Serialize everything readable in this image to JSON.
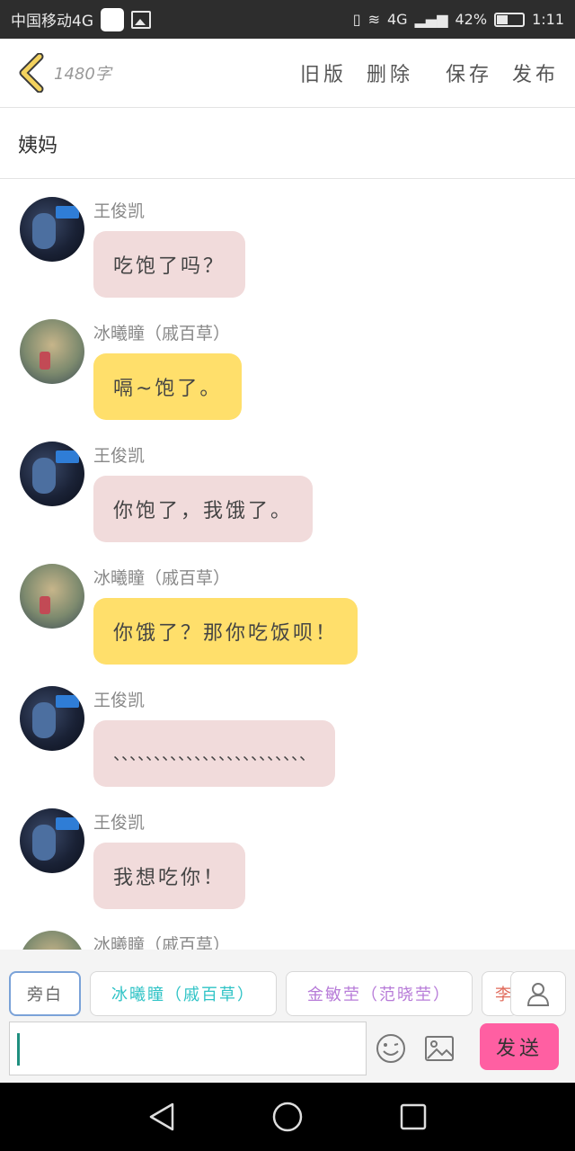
{
  "status_bar": {
    "carrier": "中国移动4G",
    "network": "4G",
    "battery_percent": "42%",
    "time": "1:11",
    "battery_level": 0.42
  },
  "toolbar": {
    "word_count": "1480字",
    "old_version": "旧版",
    "delete": "删除",
    "save": "保存",
    "publish": "发布"
  },
  "title": "姨妈",
  "messages": [
    {
      "name": "王俊凯",
      "text": "吃饱了吗？",
      "avatar": "boy",
      "color": "pink"
    },
    {
      "name": "冰曦瞳（戚百草）",
      "text": "嗝~饱了。",
      "avatar": "girl",
      "color": "yellow"
    },
    {
      "name": "王俊凯",
      "text": "你饱了，我饿了。",
      "avatar": "boy",
      "color": "pink"
    },
    {
      "name": "冰曦瞳（戚百草）",
      "text": "你饿了？那你吃饭呗！",
      "avatar": "girl",
      "color": "yellow"
    },
    {
      "name": "王俊凯",
      "text": "、、、、、、、、、、、、、、、、、、、、、、、、",
      "avatar": "boy",
      "color": "pink"
    },
    {
      "name": "王俊凯",
      "text": "我想吃你！",
      "avatar": "boy",
      "color": "pink"
    },
    {
      "name": "冰曦瞳（戚百草）",
      "text": "",
      "avatar": "girl",
      "color": "yellow"
    }
  ],
  "roles": {
    "narrator": "旁白",
    "role1": "冰曦瞳（戚百草）",
    "role2": "金敏茔（范晓茔）",
    "role3": "李"
  },
  "input": {
    "value": "",
    "send": "发送"
  },
  "colors": {
    "pink_bubble": "#f1dbdb",
    "yellow_bubble": "#ffdf6b",
    "send_button": "#ff5fa2",
    "role1": "#2fc3c6",
    "role2": "#b77bd8",
    "role3": "#e06a5a"
  },
  "icons": [
    "back-icon",
    "emoji-icon",
    "image-icon",
    "person-icon",
    "nav-back-icon",
    "nav-home-icon",
    "nav-recent-icon"
  ]
}
